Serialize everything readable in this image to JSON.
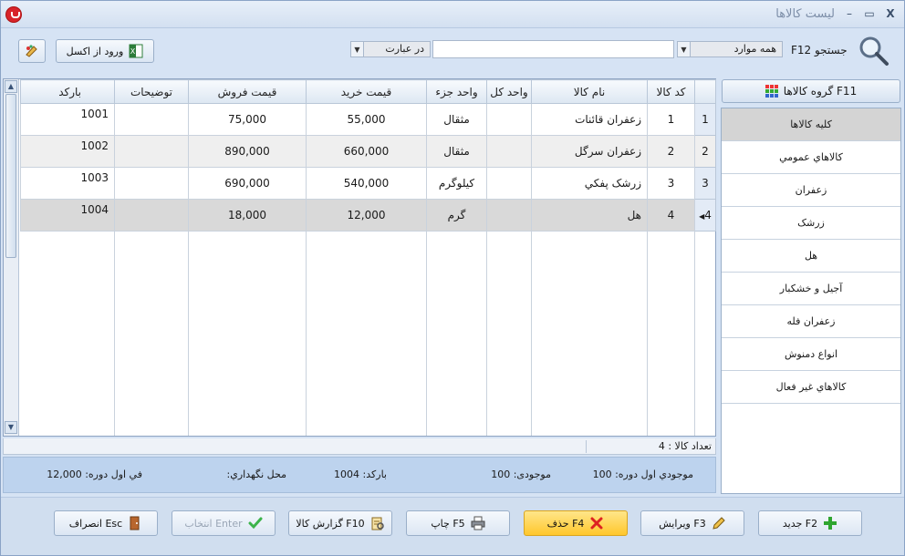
{
  "window": {
    "title": "لیست کالاها",
    "minimize": "–",
    "maximize": "▭",
    "close": "X"
  },
  "toolbar": {
    "excel_label": "ورود از اکسل",
    "search_label": "جستجو F12",
    "scope_select": "همه موارد",
    "match_select": "در عبارت",
    "search_value": ""
  },
  "grid": {
    "headers": {
      "code": "کد کالا",
      "name": "نام کالا",
      "unit_whole": "واحد کل",
      "unit_part": "واحد جزء",
      "buy_price": "قیمت خرید",
      "sell_price": "قیمت فروش",
      "notes": "توضیحات",
      "barcode": "بارکد"
    },
    "rows": [
      {
        "index": "1",
        "code": "1",
        "name": "زعفران قائنات",
        "unit_whole": "",
        "unit_part": "مثقال",
        "buy_price": "55,000",
        "sell_price": "75,000",
        "notes": "",
        "barcode": "1001"
      },
      {
        "index": "2",
        "code": "2",
        "name": "زعفران سرگل",
        "unit_whole": "",
        "unit_part": "مثقال",
        "buy_price": "660,000",
        "sell_price": "890,000",
        "notes": "",
        "barcode": "1002"
      },
      {
        "index": "3",
        "code": "3",
        "name": "زرشک پفكي",
        "unit_whole": "",
        "unit_part": "کیلوگرم",
        "buy_price": "540,000",
        "sell_price": "690,000",
        "notes": "",
        "barcode": "1003"
      },
      {
        "index": "4",
        "code": "4",
        "name": "هل",
        "unit_whole": "",
        "unit_part": "گرم",
        "buy_price": "12,000",
        "sell_price": "18,000",
        "notes": "",
        "barcode": "1004"
      }
    ]
  },
  "count_text": "تعداد کالا : 4",
  "info": {
    "first_qty": "موجودي اول دوره: 100",
    "stock": "موجودی: 100",
    "barcode": "بارکد: 1004",
    "location": "محل نگهداري:",
    "first_price": "في اول دوره: 12,000"
  },
  "groups_button": "گروه کالاها F11",
  "groups": [
    "کلیه کالاها",
    "کالاهاي عمومي",
    "زعفران",
    "زرشک",
    "هل",
    "آجیل و خشکبار",
    "زعفران فله",
    "انواع دمنوش",
    "کالاهاي غیر فعال"
  ],
  "actions": {
    "new": "جدید F2",
    "edit": "ویرایش F3",
    "delete": "حذف F4",
    "print": "چاپ F5",
    "report": "گزارش کالا F10",
    "select": "انتخاب Enter",
    "cancel": "انصراف Esc"
  },
  "colors": {
    "accent_delete": "#ffd54f",
    "selected_row": "#d9d9d9",
    "info_bar": "#bdd3ee"
  }
}
